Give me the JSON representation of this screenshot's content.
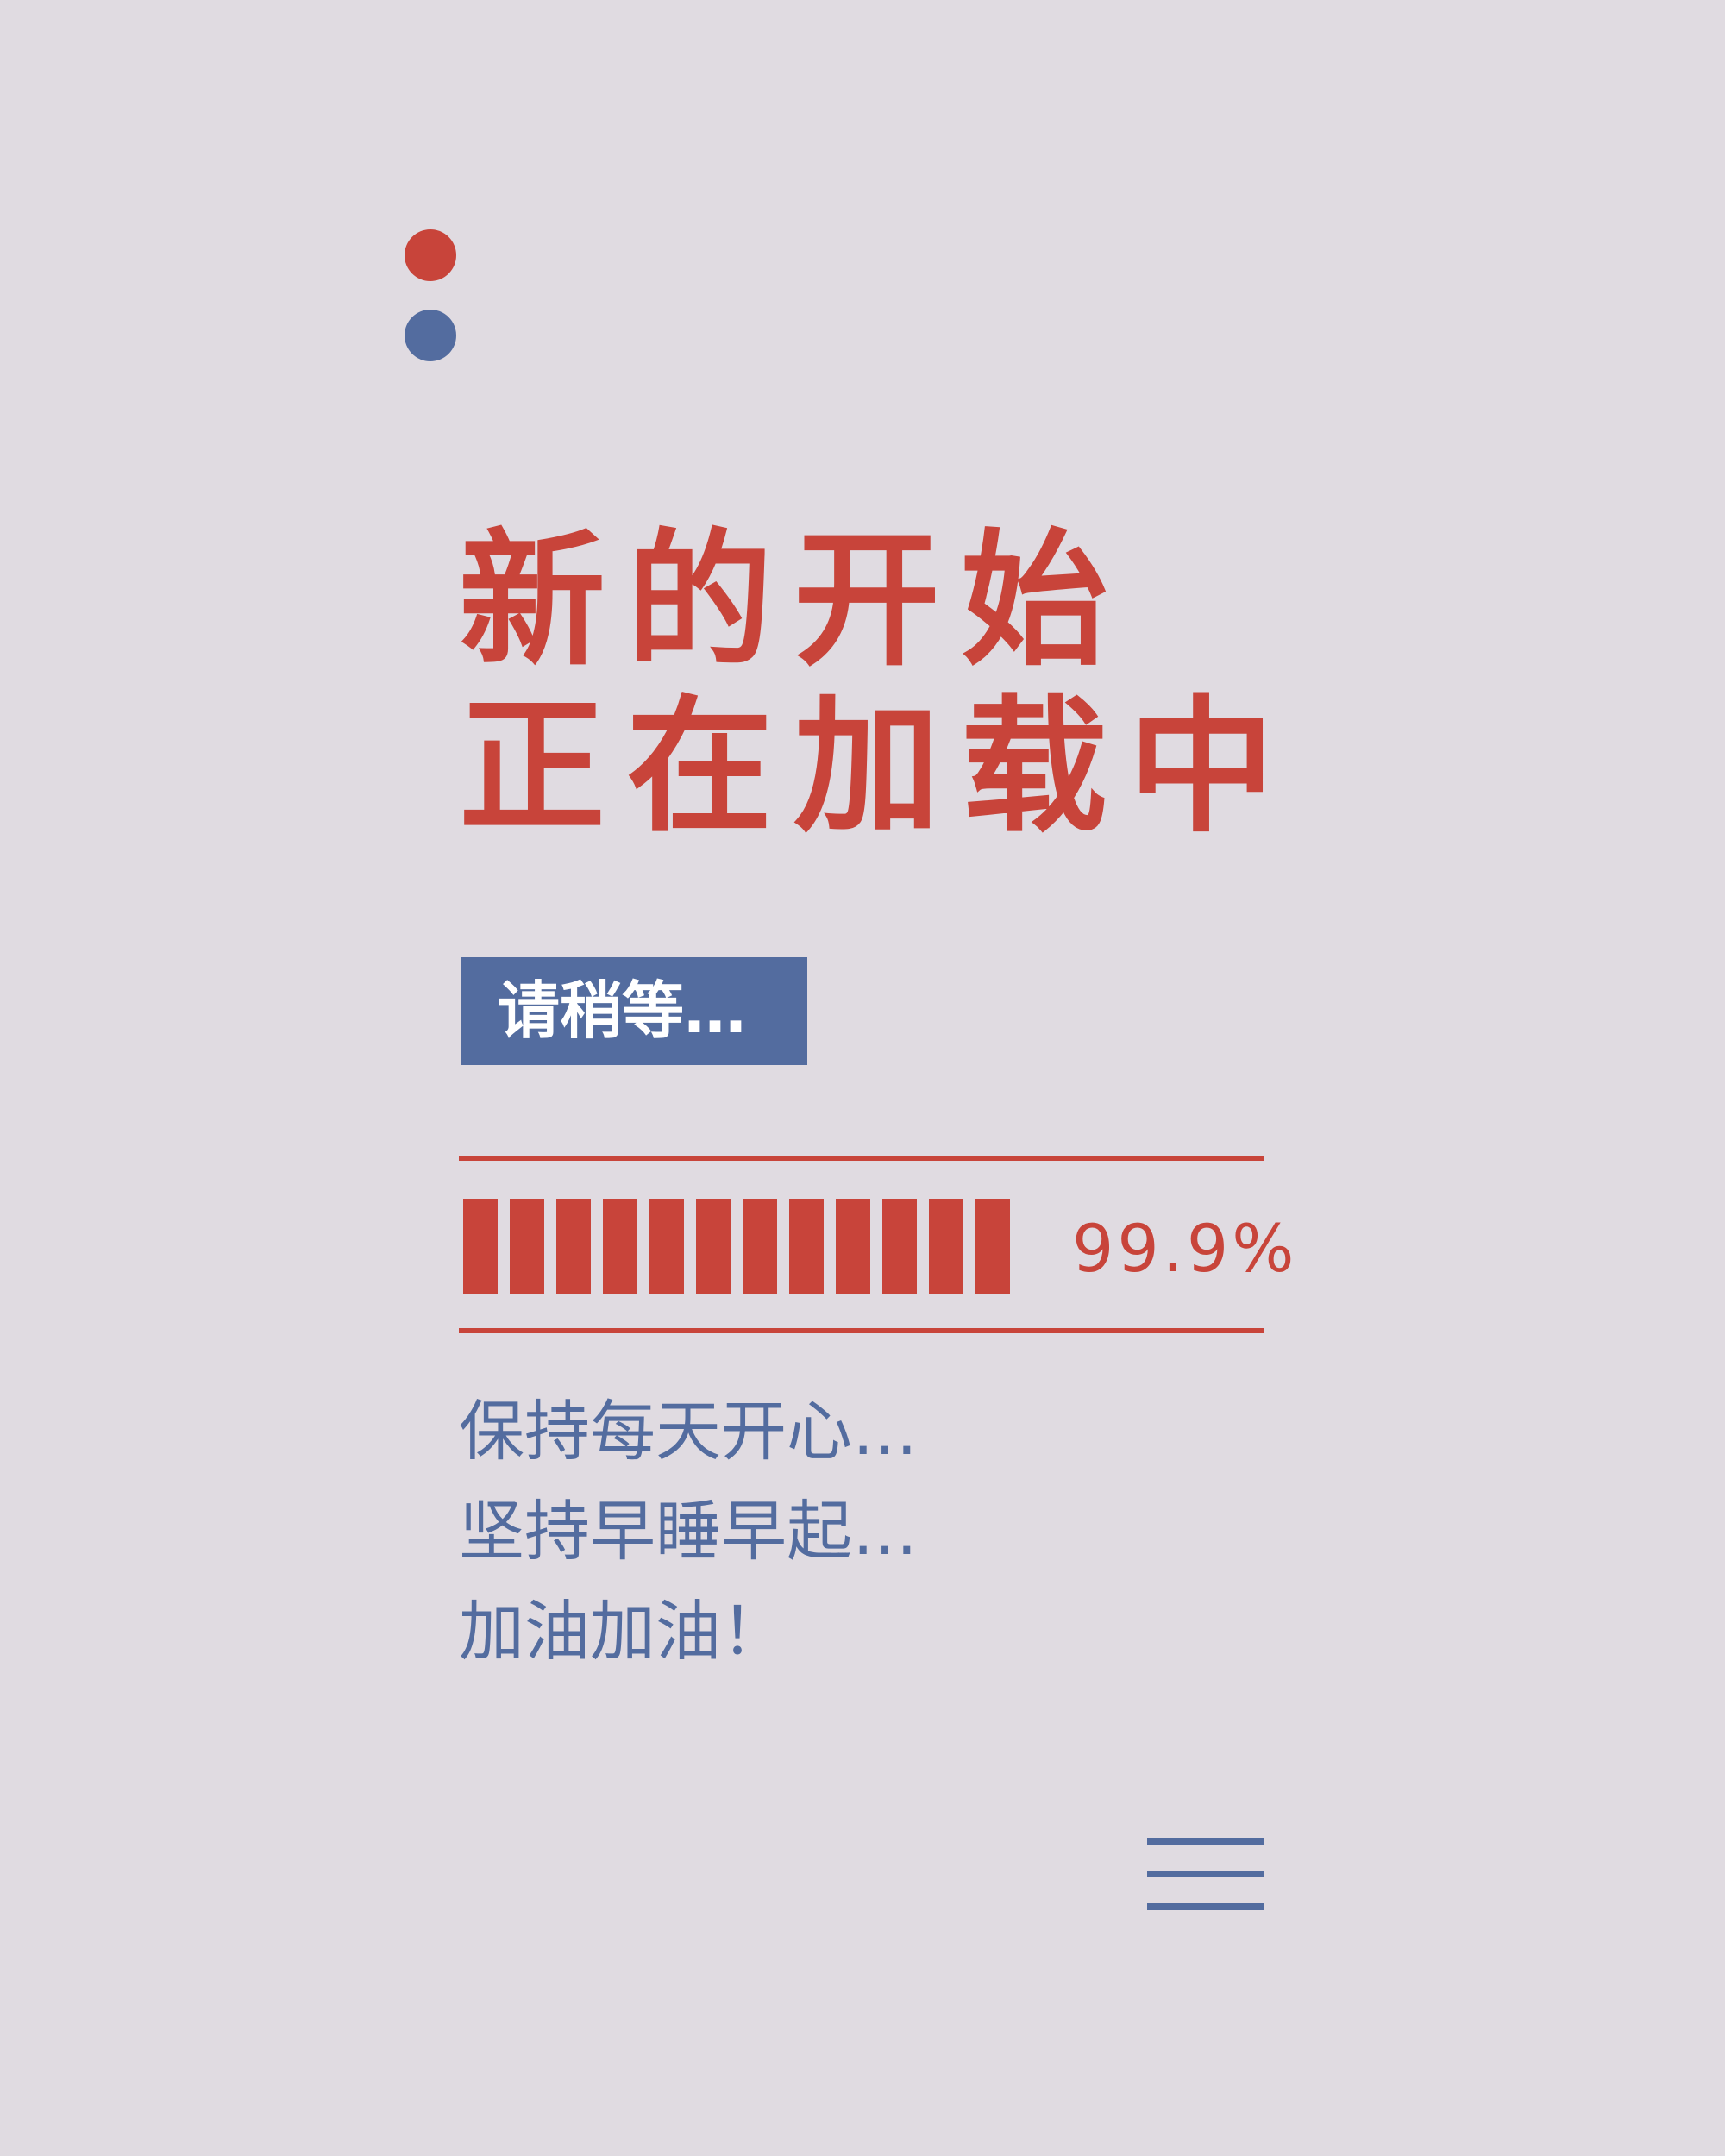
{
  "colors": {
    "background": "#e0dbe1",
    "accent_red": "#c8443a",
    "accent_blue": "#536c9f"
  },
  "headline": {
    "line1": "新的开始",
    "line2": "正在加载中"
  },
  "badge": {
    "label": "请稍等…"
  },
  "progress": {
    "percent_label": "99.9%",
    "value": 0.999,
    "segments": 12
  },
  "messages": [
    "保持每天开心…",
    "坚持早睡早起…",
    "加油加油！"
  ],
  "icons": {
    "dots": [
      "red-dot-icon",
      "blue-dot-icon"
    ],
    "menu": "menu-icon"
  }
}
